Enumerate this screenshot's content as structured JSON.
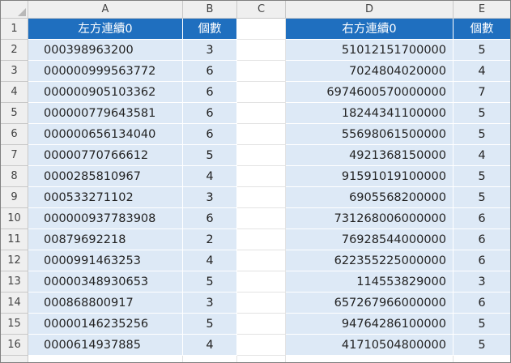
{
  "columns": [
    "A",
    "B",
    "C",
    "D",
    "E"
  ],
  "rows": [
    "1",
    "2",
    "3",
    "4",
    "5",
    "6",
    "7",
    "8",
    "9",
    "10",
    "11",
    "12",
    "13",
    "14",
    "15",
    "16"
  ],
  "headers": {
    "a": "左方連續0",
    "b": "個數",
    "d": "右方連續0",
    "e": "個數"
  },
  "data": [
    {
      "a": "000398963200",
      "b": "3",
      "d": "51012151700000",
      "e": "5"
    },
    {
      "a": "000000999563772",
      "b": "6",
      "d": "7024804020000",
      "e": "4"
    },
    {
      "a": "000000905103362",
      "b": "6",
      "d": "6974600570000000",
      "e": "7"
    },
    {
      "a": "000000779643581",
      "b": "6",
      "d": "18244341100000",
      "e": "5"
    },
    {
      "a": "000000656134040",
      "b": "6",
      "d": "55698061500000",
      "e": "5"
    },
    {
      "a": "00000770766612",
      "b": "5",
      "d": "4921368150000",
      "e": "4"
    },
    {
      "a": "0000285810967",
      "b": "4",
      "d": "91591019100000",
      "e": "5"
    },
    {
      "a": "000533271102",
      "b": "3",
      "d": "6905568200000",
      "e": "5"
    },
    {
      "a": "000000937783908",
      "b": "6",
      "d": "731268006000000",
      "e": "6"
    },
    {
      "a": "00879692218",
      "b": "2",
      "d": "76928544000000",
      "e": "6"
    },
    {
      "a": "0000991463253",
      "b": "4",
      "d": "622355225000000",
      "e": "6"
    },
    {
      "a": "00000348930653",
      "b": "5",
      "d": "114553829000",
      "e": "3"
    },
    {
      "a": "000868800917",
      "b": "3",
      "d": "657267966000000",
      "e": "6"
    },
    {
      "a": "00000146235256",
      "b": "5",
      "d": "94764286100000",
      "e": "5"
    },
    {
      "a": "0000614937885",
      "b": "4",
      "d": "41710504800000",
      "e": "5"
    }
  ],
  "colors": {
    "header_fill": "#1f6fbf",
    "body_fill": "#dde9f6",
    "sheet_header_fill": "#efefef"
  }
}
